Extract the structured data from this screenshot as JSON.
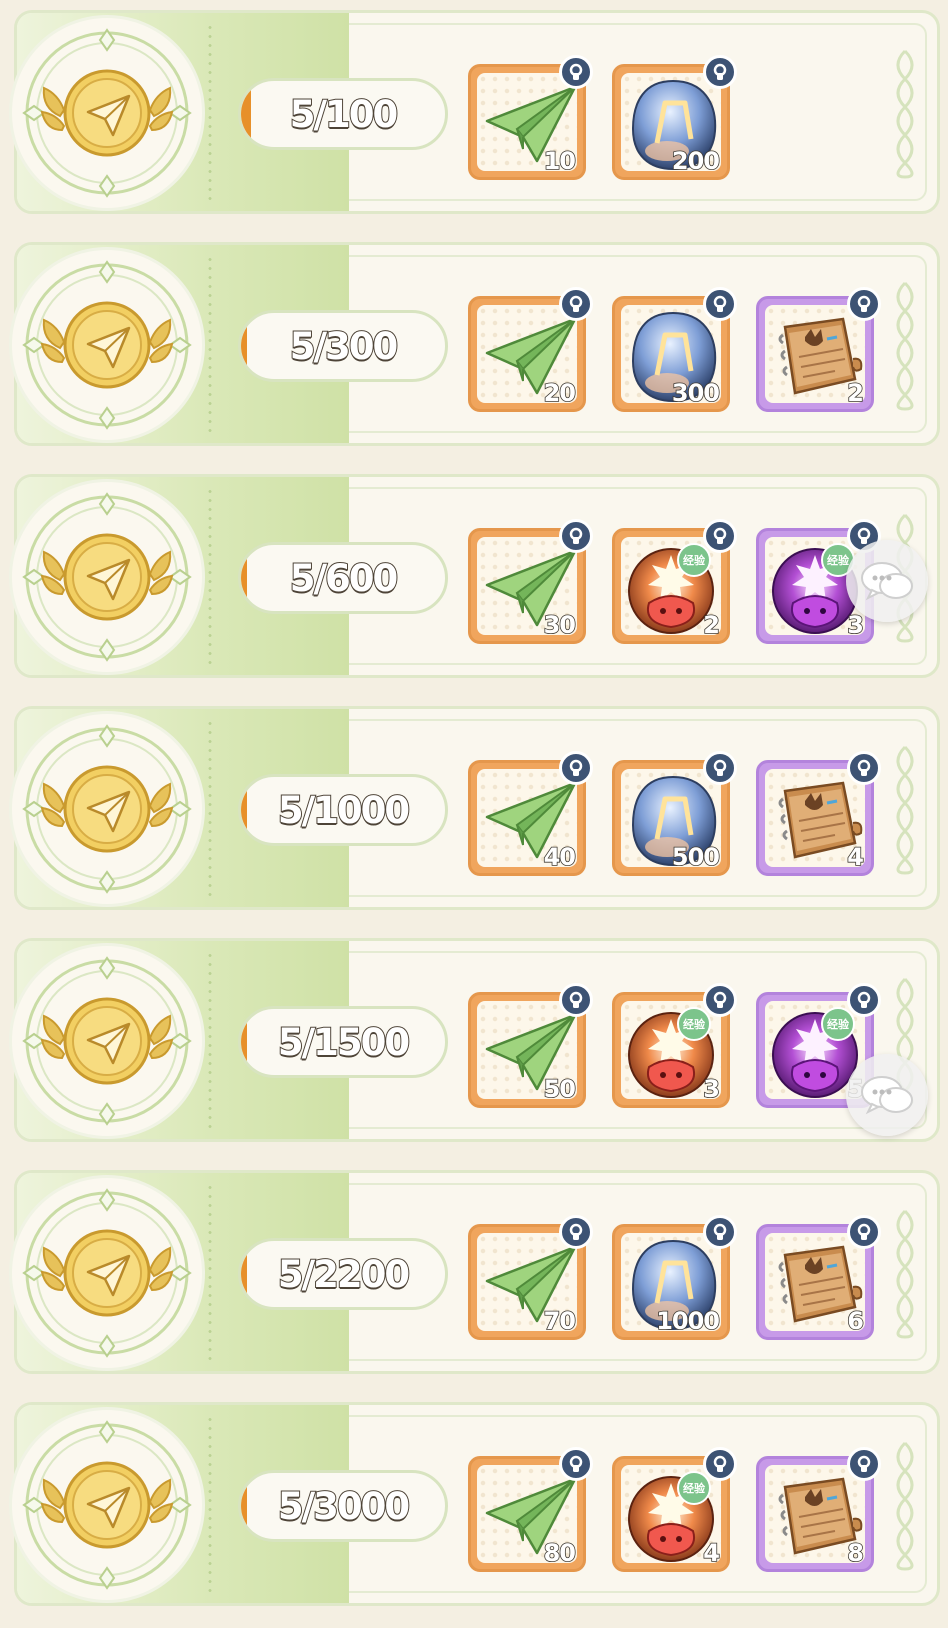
{
  "rewards_list": [
    {
      "progress": "5/100",
      "progress_fraction": 0.05,
      "items": [
        {
          "icon": "paper-plane-icon",
          "count": "10",
          "frame": "orange"
        },
        {
          "icon": "rune-crystal-icon",
          "count": "200",
          "frame": "orange"
        }
      ]
    },
    {
      "progress": "5/300",
      "progress_fraction": 0.017,
      "items": [
        {
          "icon": "paper-plane-icon",
          "count": "20",
          "frame": "orange"
        },
        {
          "icon": "rune-crystal-icon",
          "count": "300",
          "frame": "orange"
        },
        {
          "icon": "book-icon",
          "count": "2",
          "frame": "purple"
        }
      ]
    },
    {
      "progress": "5/600",
      "progress_fraction": 0.008,
      "items": [
        {
          "icon": "paper-plane-icon",
          "count": "30",
          "frame": "orange"
        },
        {
          "icon": "exp-potion-orange-icon",
          "count": "2",
          "frame": "orange",
          "tag": "经验"
        },
        {
          "icon": "exp-potion-purple-icon",
          "count": "3",
          "frame": "purple",
          "tag": "经验"
        }
      ]
    },
    {
      "progress": "5/1000",
      "progress_fraction": 0.005,
      "items": [
        {
          "icon": "paper-plane-icon",
          "count": "40",
          "frame": "orange"
        },
        {
          "icon": "rune-crystal-icon",
          "count": "500",
          "frame": "orange"
        },
        {
          "icon": "book-icon",
          "count": "4",
          "frame": "purple"
        }
      ]
    },
    {
      "progress": "5/1500",
      "progress_fraction": 0.003,
      "items": [
        {
          "icon": "paper-plane-icon",
          "count": "50",
          "frame": "orange"
        },
        {
          "icon": "exp-potion-orange-icon",
          "count": "3",
          "frame": "orange",
          "tag": "经验"
        },
        {
          "icon": "exp-potion-purple-icon",
          "count": "5",
          "frame": "purple",
          "tag": "经验"
        }
      ]
    },
    {
      "progress": "5/2200",
      "progress_fraction": 0.002,
      "items": [
        {
          "icon": "paper-plane-icon",
          "count": "70",
          "frame": "orange"
        },
        {
          "icon": "rune-crystal-icon",
          "count": "1000",
          "frame": "orange"
        },
        {
          "icon": "book-icon",
          "count": "6",
          "frame": "purple"
        }
      ]
    },
    {
      "progress": "5/3000",
      "progress_fraction": 0.002,
      "items": [
        {
          "icon": "paper-plane-icon",
          "count": "80",
          "frame": "orange"
        },
        {
          "icon": "exp-potion-orange-icon",
          "count": "4",
          "frame": "orange",
          "tag": "经验"
        },
        {
          "icon": "book-icon",
          "count": "8",
          "frame": "purple"
        }
      ]
    }
  ],
  "floating_buttons": [
    {
      "icon": "chat-bubble-icon"
    },
    {
      "icon": "chat-bubble-icon"
    }
  ],
  "colors": {
    "accent_green": "#cfe1a6",
    "progress_orange": "#e7902a",
    "frame_orange": "#f0a55d",
    "frame_purple": "#c79ae8",
    "lock_badge": "#3d5374"
  }
}
